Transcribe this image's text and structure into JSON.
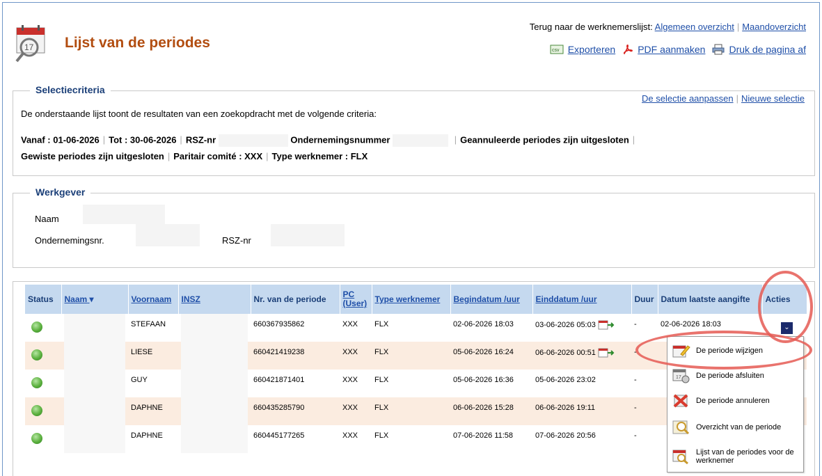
{
  "header": {
    "title": "Lijst van de periodes",
    "calendar_number": "17",
    "back_prefix": "Terug naar de werknemerslijst:",
    "link_general": "Algemeen overzicht",
    "link_month": "Maandoverzicht",
    "separator": "|",
    "export_label": "Exporteren",
    "pdf_label": "PDF aanmaken",
    "print_label": "Druk de pagina af"
  },
  "selection": {
    "legend": "Selectiecriteria",
    "link_adjust": "De selectie aanpassen",
    "link_new": "Nieuwe selectie",
    "intro": "De onderstaande lijst toont de resultaten van een zoekopdracht met de volgende criteria:",
    "from": "Vanaf : 01-06-2026",
    "to": "Tot : 30-06-2026",
    "rsz": "RSZ-nr",
    "company_no": "Ondernemingsnummer",
    "cancelled": "Geannuleerde periodes zijn uitgesloten",
    "deleted": "Gewiste periodes zijn uitgesloten",
    "pc": "Paritair comité : XXX",
    "worker_type": "Type werknemer : FLX"
  },
  "employer": {
    "legend": "Werkgever",
    "name_label": "Naam",
    "company_label": "Ondernemingsnr.",
    "rsz_label": "RSZ-nr"
  },
  "table": {
    "headers": {
      "status": "Status",
      "naam": "Naam",
      "voornaam": "Voornaam",
      "insz": "INSZ",
      "nr": "Nr. van de periode",
      "pc": "PC (User)",
      "type": "Type werknemer",
      "begin": "Begindatum /uur",
      "end": "Einddatum /uur",
      "duur": "Duur",
      "last": "Datum laatste aangifte",
      "acties": "Acties"
    },
    "rows": [
      {
        "voornaam": "STEFAAN",
        "nr": "660367935862",
        "pc": "XXX",
        "type": "FLX",
        "begin": "02-06-2026 18:03",
        "end": "03-06-2026 05:03",
        "duur": "-",
        "last": "02-06-2026 18:03"
      },
      {
        "voornaam": "LIESE",
        "nr": "660421419238",
        "pc": "XXX",
        "type": "FLX",
        "begin": "05-06-2026 16:24",
        "end": "06-06-2026 00:51",
        "duur": "-",
        "last": ""
      },
      {
        "voornaam": "GUY",
        "nr": "660421871401",
        "pc": "XXX",
        "type": "FLX",
        "begin": "05-06-2026 16:36",
        "end": "05-06-2026 23:02",
        "duur": "-",
        "last": ""
      },
      {
        "voornaam": "DAPHNE",
        "nr": "660435285790",
        "pc": "XXX",
        "type": "FLX",
        "begin": "06-06-2026 15:28",
        "end": "06-06-2026 19:11",
        "duur": "-",
        "last": ""
      },
      {
        "voornaam": "DAPHNE",
        "nr": "660445177265",
        "pc": "XXX",
        "type": "FLX",
        "begin": "07-06-2026 11:58",
        "end": "07-06-2026 20:56",
        "duur": "-",
        "last": ""
      }
    ]
  },
  "menu": {
    "edit": "De periode wijzigen",
    "close": "De periode afsluiten",
    "cancel": "De periode annuleren",
    "overview": "Overzicht van de periode",
    "list": "Lijst van de periodes voor de werknemer"
  },
  "colors": {
    "title": "#b24d10",
    "legend": "#1b3f78",
    "header_bg": "#c5d9ef",
    "row_alt": "#fbece0",
    "annotation": "#e55a54"
  }
}
